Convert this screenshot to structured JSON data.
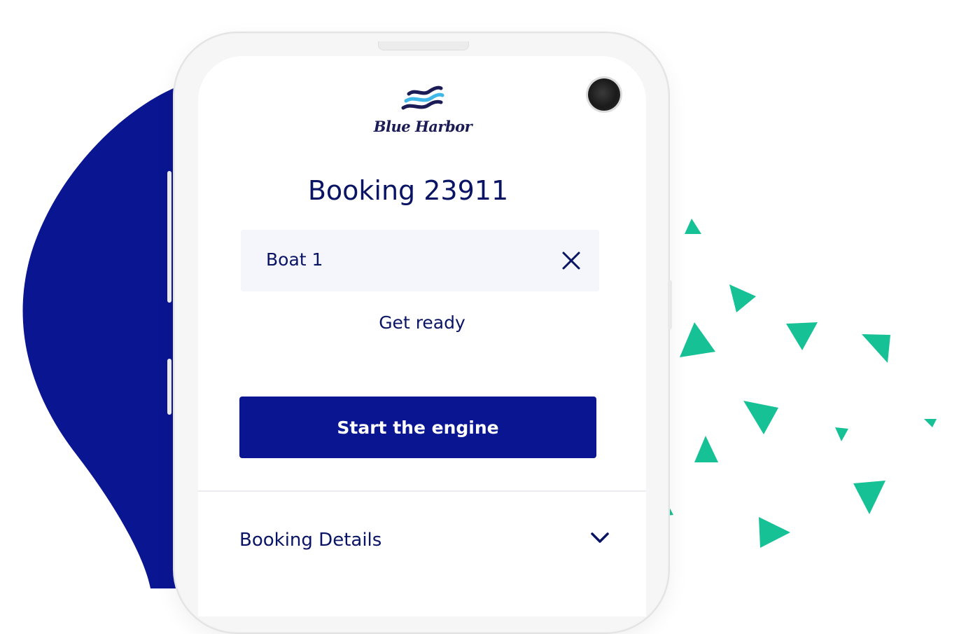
{
  "brand": {
    "name": "Blue Harbor",
    "primary_color": "#0a1591",
    "text_color": "#0a1464",
    "accent_color": "#16c195",
    "logo_wave_colors": [
      "#1b1c55",
      "#3fb7e8"
    ]
  },
  "booking": {
    "title": "Booking 23911"
  },
  "boat_card": {
    "label": "Boat 1",
    "close_icon": "close-icon"
  },
  "status": {
    "text": "Get ready"
  },
  "actions": {
    "start_label": "Start the engine"
  },
  "details": {
    "label": "Booking Details",
    "icon": "chevron-down-icon"
  }
}
